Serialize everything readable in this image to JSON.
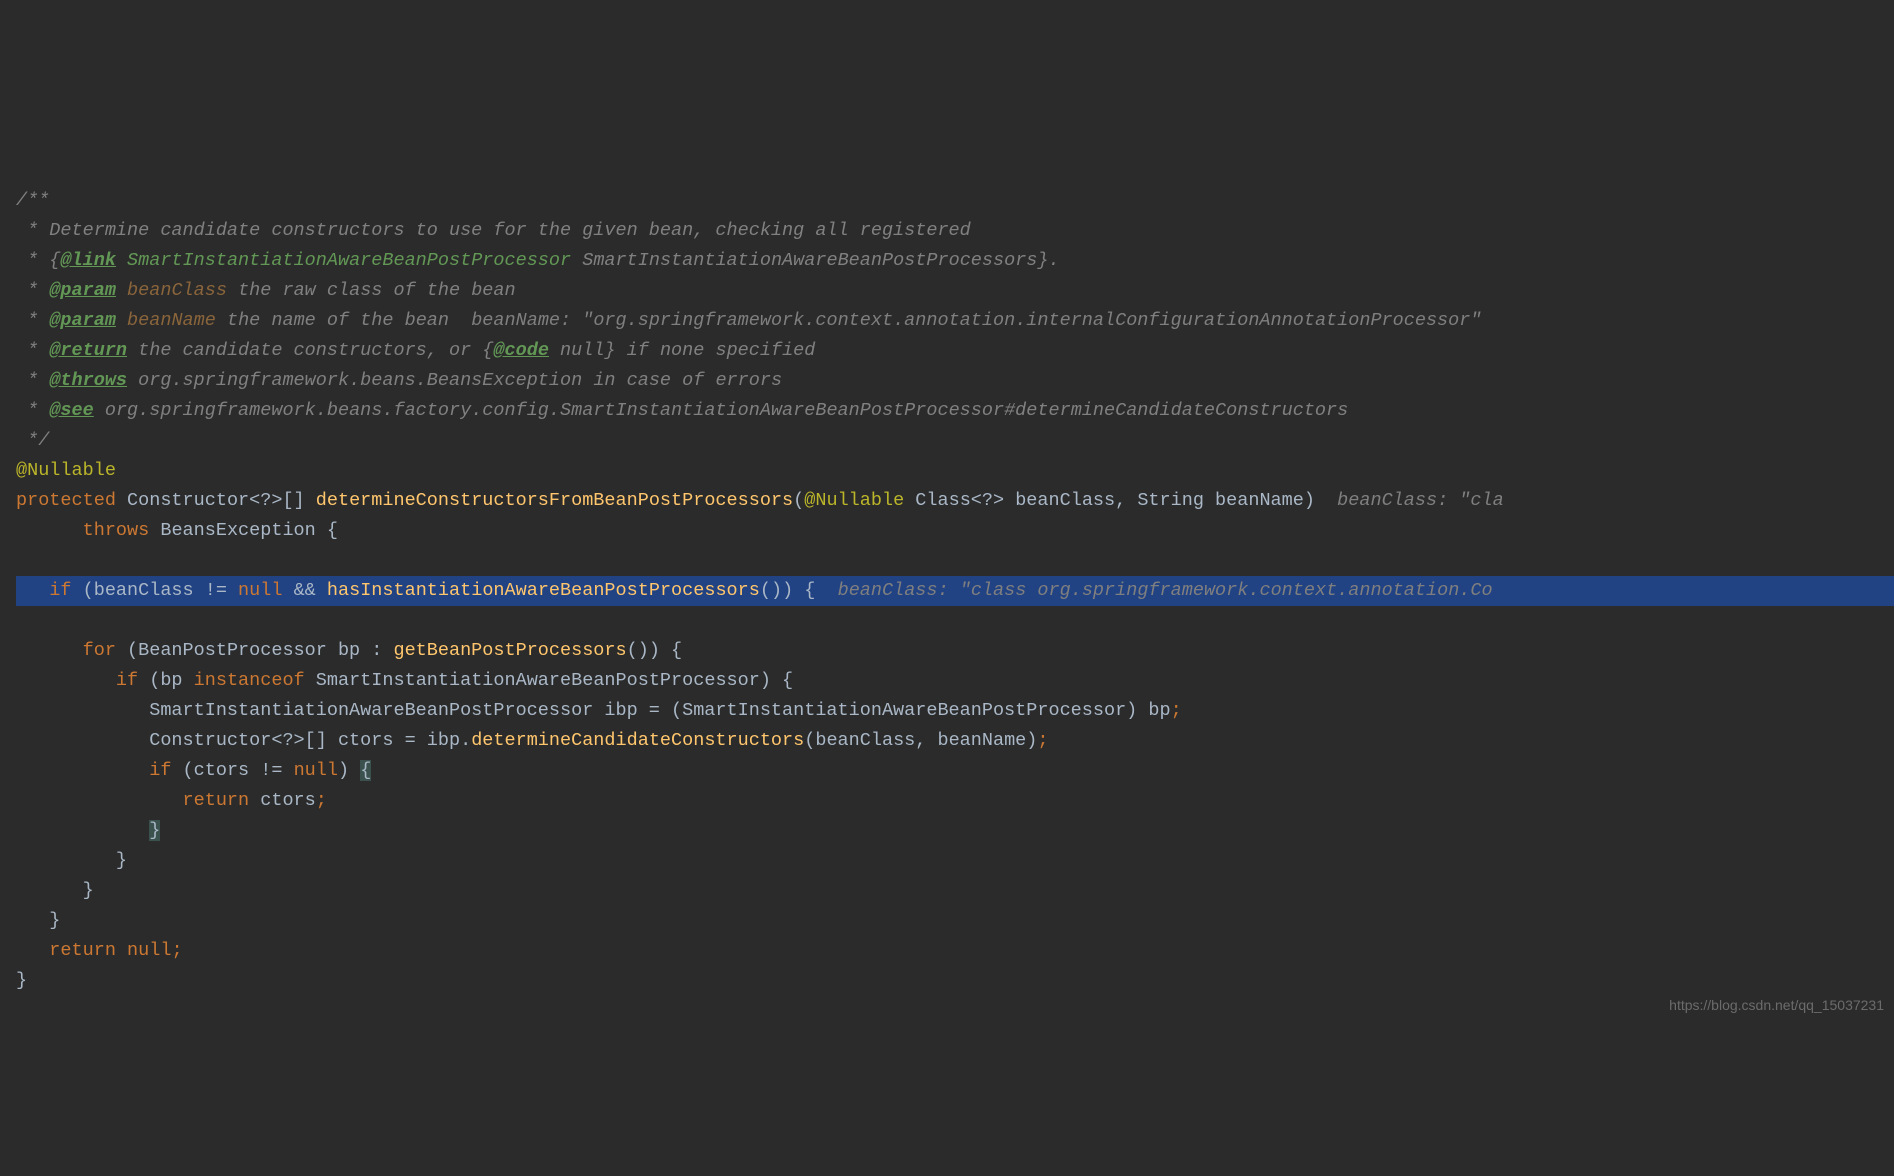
{
  "doc": {
    "l1": "/**",
    "l2_a": " * Determine candidate constructors to use for the given bean, checking all registered",
    "l3_a": " * {",
    "l3_b": "@link",
    "l3_c": " SmartInstantiationAwareBeanPostProcessor",
    "l3_d": " SmartInstantiationAwareBeanPostProcessors",
    "l3_e": "}.",
    "l4_a": " * ",
    "l4_b": "@param",
    "l4_c": " beanClass",
    "l4_d": " the raw class of the bean",
    "l5_a": " * ",
    "l5_b": "@param",
    "l5_c": " beanName",
    "l5_d": " the name of the bean  ",
    "l5_e": "beanName: \"org.springframework.context.annotation.internalConfigurationAnnotationProcessor\"",
    "l6_a": " * ",
    "l6_b": "@return",
    "l6_c": " the candidate constructors, or ",
    "l6_d": "{",
    "l6_e": "@code",
    "l6_f": " null}",
    "l6_g": " if none specified",
    "l7_a": " * ",
    "l7_b": "@throws",
    "l7_c": " org.springframework.beans.BeansException",
    "l7_d": " in case of errors",
    "l8_a": " * ",
    "l8_b": "@see",
    "l8_c": " org.springframework.beans.factory.config.SmartInstantiationAwareBeanPostProcessor#determineCandidateConstructors",
    "l9": " */"
  },
  "code": {
    "anno": "@Nullable",
    "sig_a": "protected",
    "sig_b": " Constructor<?>[] ",
    "sig_c": "determineConstructorsFromBeanPostProcessors",
    "sig_d": "(",
    "sig_e": "@Nullable",
    "sig_f": " Class<?> beanClass, String beanName)  ",
    "sig_g": "beanClass: \"cla",
    "throws_a": "      throws",
    "throws_b": " BeansException {",
    "if_a": "   if",
    "if_b": " (beanClass != ",
    "if_c": "null",
    "if_d": " && ",
    "if_e": "hasInstantiationAwareBeanPostProcessors",
    "if_f": "()) {  ",
    "if_g": "beanClass: \"class org.springframework.context.annotation.Co",
    "for_a": "      for",
    "for_b": " (BeanPostProcessor bp : ",
    "for_c": "getBeanPostProcessors",
    "for_d": "()) {",
    "if2_a": "         if",
    "if2_b": " (bp ",
    "if2_c": "instanceof",
    "if2_d": " SmartInstantiationAwareBeanPostProcessor) {",
    "l_cast": "            SmartInstantiationAwareBeanPostProcessor ibp = (SmartInstantiationAwareBeanPostProcessor) bp",
    "semi": ";",
    "l_ctors_a": "            Constructor<?>[] ctors = ibp.",
    "l_ctors_b": "determineCandidateConstructors",
    "l_ctors_c": "(beanClass, beanName)",
    "if3_a": "            if",
    "if3_b": " (ctors != ",
    "if3_c": "null",
    "if3_d": ") ",
    "if3_e": "{",
    "ret_a": "               return",
    "ret_b": " ctors",
    "close1_a": "            ",
    "close1_b": "}",
    "close2": "         }",
    "close3": "      }",
    "close4": "   }",
    "retnull_a": "   return null",
    "close5": "}"
  },
  "watermark": "https://blog.csdn.net/qq_15037231"
}
